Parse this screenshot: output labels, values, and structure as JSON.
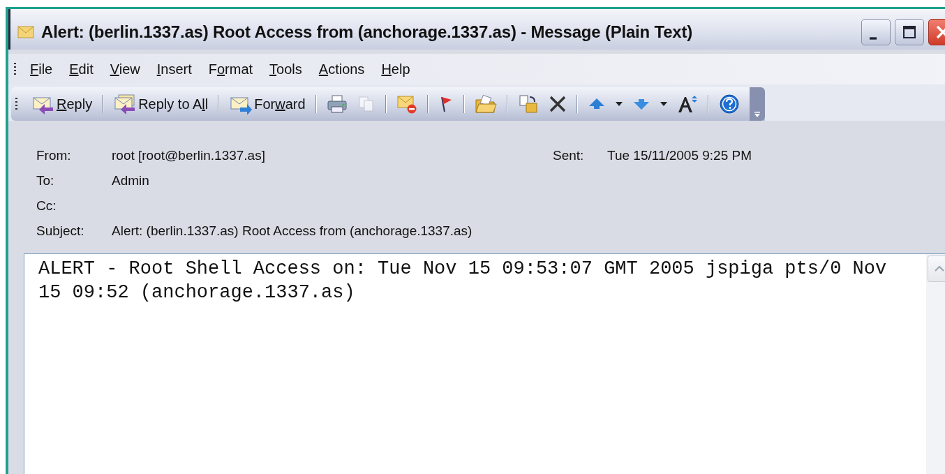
{
  "window": {
    "title": "Alert: (berlin.1337.as) Root Access from (anchorage.1337.as) - Message (Plain Text)"
  },
  "menu": [
    {
      "key": "F",
      "post": "ile"
    },
    {
      "key": "E",
      "post": "dit"
    },
    {
      "key": "V",
      "post": "iew"
    },
    {
      "key": "I",
      "post": "nsert"
    },
    {
      "pre": "F",
      "key": "o",
      "post": "rmat"
    },
    {
      "key": "T",
      "post": "ools"
    },
    {
      "key": "A",
      "post": "ctions"
    },
    {
      "key": "H",
      "post": "elp"
    }
  ],
  "toolbar": {
    "buttons": [
      {
        "key": "R",
        "post": "eply"
      },
      {
        "pre": "Reply to A",
        "key": "l",
        "post": "l"
      },
      {
        "pre": "For",
        "key": "w",
        "post": "ard"
      }
    ]
  },
  "header": {
    "from_label": "From:",
    "from": "root [root@berlin.1337.as]",
    "sent_label": "Sent:",
    "sent": "Tue 15/11/2005 9:25 PM",
    "to_label": "To:",
    "to": "Admin",
    "cc_label": "Cc:",
    "subject_label": "Subject:",
    "subject": "Alert: (berlin.1337.as) Root Access from (anchorage.1337.as)"
  },
  "body": {
    "text": "ALERT - Root Shell Access on: Tue Nov 15 09:53:07 GMT 2005 jspiga pts/0 Nov 15 09:52 (anchorage.1337.as)"
  }
}
